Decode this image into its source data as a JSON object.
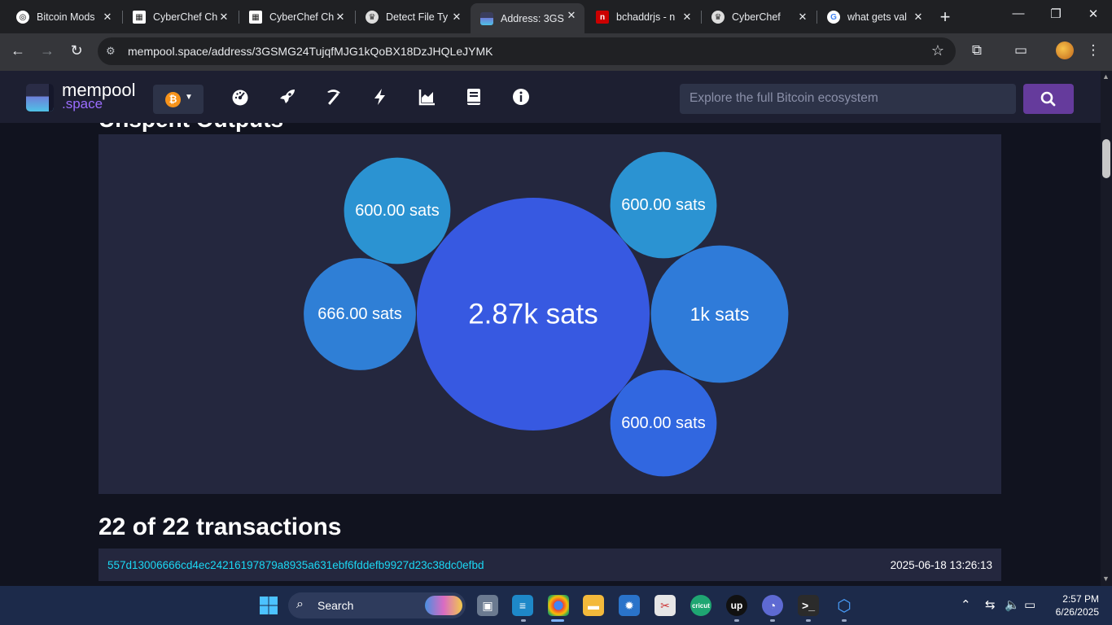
{
  "browser": {
    "tabs": [
      {
        "label": "Bitcoin Mods",
        "icon": "openai-icon"
      },
      {
        "label": "CyberChef Ch",
        "icon": "cyberchef-icon"
      },
      {
        "label": "CyberChef Ch",
        "icon": "cyberchef-icon"
      },
      {
        "label": "Detect File Ty",
        "icon": "chef-hat-icon"
      },
      {
        "label": "Address: 3GS",
        "icon": "mempool-icon"
      },
      {
        "label": "bchaddrjs - n",
        "icon": "npm-icon"
      },
      {
        "label": "CyberChef",
        "icon": "chef-hat-icon"
      },
      {
        "label": "what gets val",
        "icon": "google-icon"
      }
    ],
    "url": "mempool.space/address/3GSMG24TujqfMJG1kQoBX18DzJHQLeJYMK"
  },
  "mempool": {
    "logo_line1": "mempool",
    "logo_line2": ".space",
    "search_placeholder": "Explore the full Bitcoin ecosystem",
    "nav_icons": [
      "dashboard-icon",
      "rocket-icon",
      "mining-icon",
      "lightning-icon",
      "graphs-icon",
      "docs-icon",
      "about-icon"
    ]
  },
  "section_title": "Unspent Outputs",
  "chart_data": {
    "type": "bubble",
    "bubbles": [
      {
        "label": "2.87k sats",
        "value": 2870,
        "color": "#3759e1"
      },
      {
        "label": "1k sats",
        "value": 1000,
        "color": "#2f7bd9"
      },
      {
        "label": "666.00 sats",
        "value": 666,
        "color": "#2f7fd6"
      },
      {
        "label": "600.00 sats",
        "value": 600,
        "color": "#2b93d2"
      },
      {
        "label": "600.00 sats",
        "value": 600,
        "color": "#2b93d2"
      },
      {
        "label": "600.00 sats",
        "value": 600,
        "color": "#3167e0"
      }
    ]
  },
  "transactions": {
    "heading": "22 of 22 transactions",
    "rows": [
      {
        "txid": "557d13006666cd4ec24216197879a8935a631ebf6fddefb9927d23c38dc0efbd",
        "time": "2025-06-18 13:26:13"
      }
    ]
  },
  "taskbar": {
    "search_label": "Search",
    "time": "2:57 PM",
    "date": "6/26/2025"
  }
}
